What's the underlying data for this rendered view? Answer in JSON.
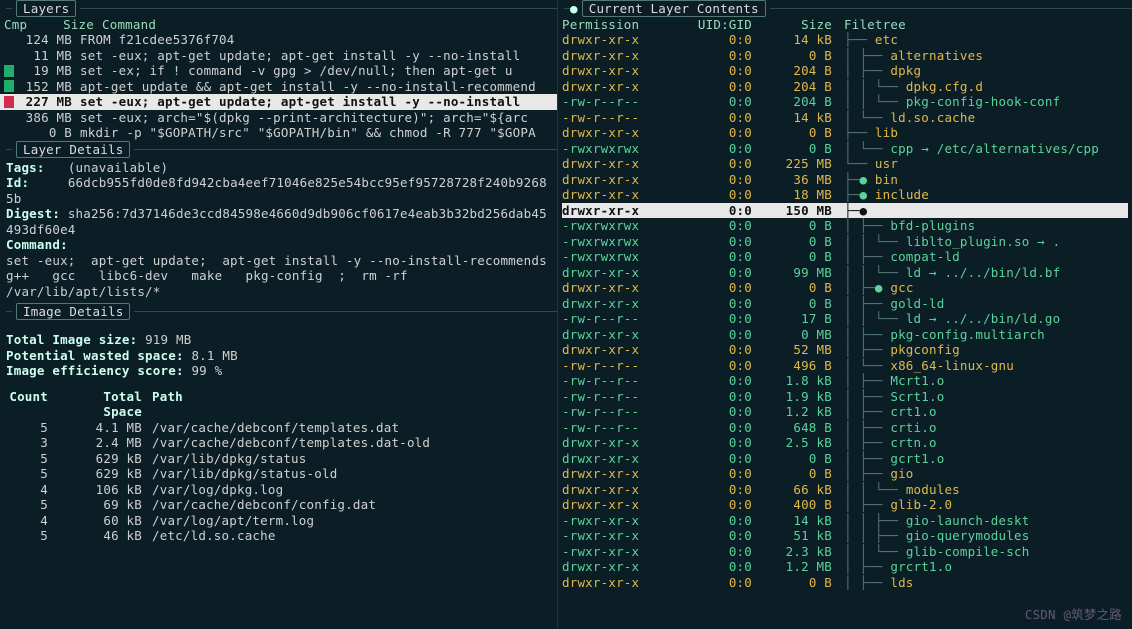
{
  "sections": {
    "layers": "Layers",
    "layer_details": "Layer Details",
    "image_details": "Image Details",
    "current_layer": "Current Layer Contents"
  },
  "layer_cols": {
    "cmp": "Cmp",
    "size": "Size",
    "command": "Command"
  },
  "layers": [
    {
      "glyph": "",
      "size": "124 MB",
      "cmd": "FROM f21cdee5376f704"
    },
    {
      "glyph": "",
      "size": "11 MB",
      "cmd": "set -eux;  apt-get update;  apt-get install -y --no-install"
    },
    {
      "glyph": "grn",
      "size": "19 MB",
      "cmd": "set -ex;  if ! command -v gpg > /dev/null; then   apt-get u"
    },
    {
      "glyph": "grn",
      "size": "152 MB",
      "cmd": "apt-get update && apt-get install -y --no-install-recommend"
    },
    {
      "glyph": "mag",
      "size": "227 MB",
      "cmd": "set -eux;  apt-get update;  apt-get install -y --no-install",
      "selected": true
    },
    {
      "glyph": "",
      "size": "386 MB",
      "cmd": "set -eux;  arch=\"$(dpkg --print-architecture)\"; arch=\"${arc"
    },
    {
      "glyph": "",
      "size": "0 B",
      "cmd": "mkdir -p \"$GOPATH/src\" \"$GOPATH/bin\" && chmod -R 777 \"$GOPA"
    }
  ],
  "layer_details": {
    "tags_label": "Tags:",
    "tags": "(unavailable)",
    "id_label": "Id:",
    "id": "66dcb955fd0de8fd942cba4eef71046e825e54bcc95ef95728728f240b92685b",
    "digest_label": "Digest:",
    "digest": "sha256:7d37146de3ccd84598e4660d9db906cf0617e4eab3b32bd256dab45493df60e4",
    "command_label": "Command:",
    "command": "set -eux;  apt-get update;  apt-get install -y --no-install-recommends   g++   gcc   libc6-dev   make   pkg-config  ;  rm -rf /var/lib/apt/lists/*"
  },
  "image_details": {
    "total_label": "Total Image size:",
    "total": "919 MB",
    "wasted_label": "Potential wasted space:",
    "wasted": "8.1 MB",
    "eff_label": "Image efficiency score:",
    "eff": "99 %"
  },
  "waste_cols": {
    "count": "Count",
    "total": "Total Space",
    "path": "Path"
  },
  "waste": [
    {
      "count": "5",
      "size": "4.1 MB",
      "path": "/var/cache/debconf/templates.dat"
    },
    {
      "count": "3",
      "size": "2.4 MB",
      "path": "/var/cache/debconf/templates.dat-old"
    },
    {
      "count": "5",
      "size": "629 kB",
      "path": "/var/lib/dpkg/status"
    },
    {
      "count": "5",
      "size": "629 kB",
      "path": "/var/lib/dpkg/status-old"
    },
    {
      "count": "4",
      "size": "106 kB",
      "path": "/var/log/dpkg.log"
    },
    {
      "count": "5",
      "size": "69 kB",
      "path": "/var/cache/debconf/config.dat"
    },
    {
      "count": "4",
      "size": "60 kB",
      "path": "/var/log/apt/term.log"
    },
    {
      "count": "5",
      "size": "46 kB",
      "path": "/etc/ld.so.cache"
    }
  ],
  "content_cols": {
    "perm": "Permission",
    "uid": "UID:GID",
    "size": "Size",
    "ft": "Filetree"
  },
  "tree": [
    {
      "perm": "drwxr-xr-x",
      "uid": "0:0",
      "size": "14 kB",
      "cls": "ylw",
      "pre": "├── ",
      "name": "etc"
    },
    {
      "perm": "drwxr-xr-x",
      "uid": "0:0",
      "size": "0 B",
      "cls": "ylw",
      "pre": "│   ├── ",
      "name": "alternatives"
    },
    {
      "perm": "drwxr-xr-x",
      "uid": "0:0",
      "size": "204 B",
      "cls": "ylw",
      "pre": "│   ├── ",
      "name": "dpkg"
    },
    {
      "perm": "drwxr-xr-x",
      "uid": "0:0",
      "size": "204 B",
      "cls": "ylw",
      "pre": "│   │   └── ",
      "name": "dpkg.cfg.d"
    },
    {
      "perm": "-rw-r--r--",
      "uid": "0:0",
      "size": "204 B",
      "cls": "grn",
      "pre": "│   │       └── ",
      "name": "pkg-config-hook-conf"
    },
    {
      "perm": "-rw-r--r--",
      "uid": "0:0",
      "size": "14 kB",
      "cls": "ylw",
      "pre": "│   └── ",
      "name": "ld.so.cache"
    },
    {
      "perm": "drwxr-xr-x",
      "uid": "0:0",
      "size": "0 B",
      "cls": "ylw",
      "pre": "├── ",
      "name": "lib"
    },
    {
      "perm": "-rwxrwxrwx",
      "uid": "0:0",
      "size": "0 B",
      "cls": "grn",
      "pre": "│   └── ",
      "name": "cpp → /etc/alternatives/cpp"
    },
    {
      "perm": "drwxr-xr-x",
      "uid": "0:0",
      "size": "225 MB",
      "cls": "ylw",
      "pre": "└── ",
      "name": "usr"
    },
    {
      "perm": "drwxr-xr-x",
      "uid": "0:0",
      "size": "36 MB",
      "cls": "ylw",
      "pre": "    ├─● ",
      "name": "bin"
    },
    {
      "perm": "drwxr-xr-x",
      "uid": "0:0",
      "size": "18 MB",
      "cls": "ylw",
      "pre": "    ├─● ",
      "name": "include"
    },
    {
      "perm": "drwxr-xr-x",
      "uid": "0:0",
      "size": "150 MB",
      "cls": "sel",
      "pre": "    ├─● ",
      "name": "lib",
      "selected": true
    },
    {
      "perm": "-rwxrwxrwx",
      "uid": "0:0",
      "size": "0 B",
      "cls": "grn",
      "pre": "    │   ├── ",
      "name": "bfd-plugins"
    },
    {
      "perm": "-rwxrwxrwx",
      "uid": "0:0",
      "size": "0 B",
      "cls": "grn",
      "pre": "    │   │   └── ",
      "name": "liblto_plugin.so → ."
    },
    {
      "perm": "-rwxrwxrwx",
      "uid": "0:0",
      "size": "0 B",
      "cls": "grn",
      "pre": "    │   ├── ",
      "name": "compat-ld"
    },
    {
      "perm": "drwxr-xr-x",
      "uid": "0:0",
      "size": "99 MB",
      "cls": "grn",
      "pre": "    │   │   └── ",
      "name": "ld → ../../bin/ld.bf"
    },
    {
      "perm": "drwxr-xr-x",
      "uid": "0:0",
      "size": "0 B",
      "cls": "ylw",
      "pre": "    │   ├─● ",
      "name": "gcc"
    },
    {
      "perm": "drwxr-xr-x",
      "uid": "0:0",
      "size": "0 B",
      "cls": "grn",
      "pre": "    │   ├── ",
      "name": "gold-ld"
    },
    {
      "perm": "-rw-r--r--",
      "uid": "0:0",
      "size": "17 B",
      "cls": "grn",
      "pre": "    │   │   └── ",
      "name": "ld → ../../bin/ld.go"
    },
    {
      "perm": "drwxr-xr-x",
      "uid": "0:0",
      "size": "0 MB",
      "cls": "grn",
      "pre": "    │   ├── ",
      "name": "pkg-config.multiarch"
    },
    {
      "perm": "drwxr-xr-x",
      "uid": "0:0",
      "size": "52 MB",
      "cls": "ylw",
      "pre": "    │   ├── ",
      "name": "pkgconfig"
    },
    {
      "perm": "-rw-r--r--",
      "uid": "0:0",
      "size": "496 B",
      "cls": "ylw",
      "pre": "    │   └── ",
      "name": "x86_64-linux-gnu"
    },
    {
      "perm": "-rw-r--r--",
      "uid": "0:0",
      "size": "1.8 kB",
      "cls": "grn",
      "pre": "    │       ├── ",
      "name": "Mcrt1.o"
    },
    {
      "perm": "-rw-r--r--",
      "uid": "0:0",
      "size": "1.9 kB",
      "cls": "grn",
      "pre": "    │       ├── ",
      "name": "Scrt1.o"
    },
    {
      "perm": "-rw-r--r--",
      "uid": "0:0",
      "size": "1.2 kB",
      "cls": "grn",
      "pre": "    │       ├── ",
      "name": "crt1.o"
    },
    {
      "perm": "-rw-r--r--",
      "uid": "0:0",
      "size": "648 B",
      "cls": "grn",
      "pre": "    │       ├── ",
      "name": "crti.o"
    },
    {
      "perm": "drwxr-xr-x",
      "uid": "0:0",
      "size": "2.5 kB",
      "cls": "grn",
      "pre": "    │       ├── ",
      "name": "crtn.o"
    },
    {
      "perm": "drwxr-xr-x",
      "uid": "0:0",
      "size": "0 B",
      "cls": "grn",
      "pre": "    │       ├── ",
      "name": "gcrt1.o"
    },
    {
      "perm": "drwxr-xr-x",
      "uid": "0:0",
      "size": "0 B",
      "cls": "ylw",
      "pre": "    │       ├── ",
      "name": "gio"
    },
    {
      "perm": "drwxr-xr-x",
      "uid": "0:0",
      "size": "66 kB",
      "cls": "ylw",
      "pre": "    │       │   └── ",
      "name": "modules"
    },
    {
      "perm": "drwxr-xr-x",
      "uid": "0:0",
      "size": "400 B",
      "cls": "ylw",
      "pre": "    │       ├── ",
      "name": "glib-2.0"
    },
    {
      "perm": "-rwxr-xr-x",
      "uid": "0:0",
      "size": "14 kB",
      "cls": "grn",
      "pre": "    │       │   ├── ",
      "name": "gio-launch-deskt"
    },
    {
      "perm": "-rwxr-xr-x",
      "uid": "0:0",
      "size": "51 kB",
      "cls": "grn",
      "pre": "    │       │   ├── ",
      "name": "gio-querymodules"
    },
    {
      "perm": "-rwxr-xr-x",
      "uid": "0:0",
      "size": "2.3 kB",
      "cls": "grn",
      "pre": "    │       │   └── ",
      "name": "glib-compile-sch"
    },
    {
      "perm": "drwxr-xr-x",
      "uid": "0:0",
      "size": "1.2 MB",
      "cls": "grn",
      "pre": "    │       ├── ",
      "name": "grcrt1.o"
    },
    {
      "perm": "drwxr-xr-x",
      "uid": "0:0",
      "size": "0 B",
      "cls": "ylw",
      "pre": "    │       ├── ",
      "name": "lds"
    }
  ],
  "watermark": "CSDN @筑梦之路"
}
